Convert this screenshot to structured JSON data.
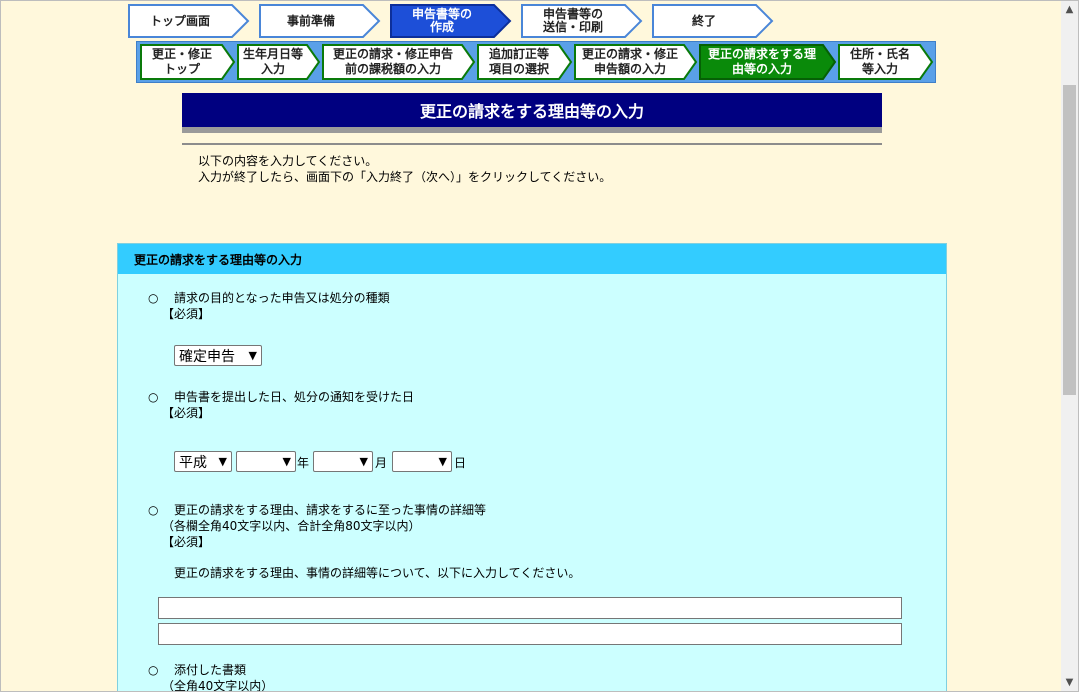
{
  "steps": [
    {
      "label": "トップ画面",
      "active": false
    },
    {
      "label": "事前準備",
      "active": false
    },
    {
      "label": "申告書等の\n作成",
      "active": true
    },
    {
      "label": "申告書等の\n送信・印刷",
      "active": false
    },
    {
      "label": "終了",
      "active": false
    }
  ],
  "substeps": [
    {
      "label": "更正・修正\nトップ",
      "active": false
    },
    {
      "label": "生年月日等\n入力",
      "active": false
    },
    {
      "label": "更正の請求・修正申告\n前の課税額の入力",
      "active": false
    },
    {
      "label": "追加訂正等\n項目の選択",
      "active": false
    },
    {
      "label": "更正の請求・修正\n申告額の入力",
      "active": false
    },
    {
      "label": "更正の請求をする理\n由等の入力",
      "active": true
    },
    {
      "label": "住所・氏名\n等入力",
      "active": false
    }
  ],
  "page_title": "更正の請求をする理由等の入力",
  "intro": {
    "line1": "以下の内容を入力してください。",
    "line2": "入力が終了したら、画面下の「入力終了（次へ）」をクリックしてください。"
  },
  "panel": {
    "title": "更正の請求をする理由等の入力",
    "q1": {
      "mark": "○",
      "label": "請求の目的となった申告又は処分の種類",
      "required": "【必須】",
      "select_value": "確定申告"
    },
    "q2": {
      "mark": "○",
      "label": "申告書を提出した日、処分の通知を受けた日",
      "required": "【必須】",
      "era": "平成",
      "year": "",
      "month": "",
      "day": "",
      "year_unit": "年",
      "month_unit": "月",
      "day_unit": "日"
    },
    "q3": {
      "mark": "○",
      "label": "更正の請求をする理由、請求をするに至った事情の詳細等",
      "note": "（各欄全角40文字以内、合計全角80文字以内）",
      "required": "【必須】",
      "instruction": "更正の請求をする理由、事情の詳細等について、以下に入力してください。",
      "line1": "",
      "line2": ""
    },
    "q4": {
      "mark": "○",
      "label": "添付した書類",
      "note": "（全角40文字以内）"
    }
  },
  "colors": {
    "active_step": "#1d4fd8",
    "active_substep": "#0a8a0a",
    "title_bg": "#000080",
    "panel_head": "#33ccff",
    "panel_bg": "#ccffff",
    "page_bg": "#fff8dc"
  },
  "icons": {
    "select_arrow": "chevron-down-icon",
    "scroll_up": "scroll-up-arrow-icon",
    "scroll_down": "scroll-down-arrow-icon"
  }
}
